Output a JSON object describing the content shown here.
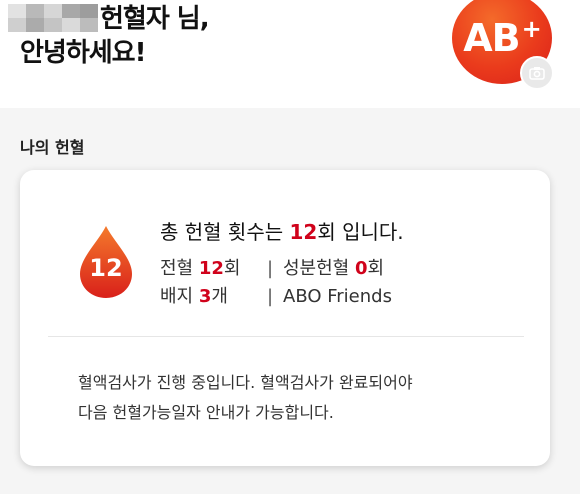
{
  "header": {
    "greeting_line1": "헌혈자 님,",
    "greeting_line2": "안녕하세요!",
    "blood_type": "AB",
    "blood_rh": "+",
    "avatar_color": "#ea3b1c"
  },
  "section": {
    "title": "나의 헌혈"
  },
  "summary": {
    "total_count": "12",
    "headline_prefix": "총 헌혈 횟수는 ",
    "headline_unit": "회",
    "headline_suffix": " 입니다.",
    "whole_blood_label": "전혈 ",
    "whole_blood_count": "12",
    "whole_blood_unit": "회",
    "component_label": "성분헌혈 ",
    "component_count": "0",
    "component_unit": "회",
    "badge_label": "배지 ",
    "badge_count": "3",
    "badge_unit": "개",
    "group_name": "ABO Friends",
    "separator": "|"
  },
  "notice": {
    "line1": "혈액검사가 진행 중입니다. 혈액검사가 완료되어야",
    "line2": "다음 헌혈가능일자 안내가 가능합니다."
  },
  "colors": {
    "accent": "#d0021b",
    "drop_top": "#f47a2c",
    "drop_bottom": "#d9201a"
  }
}
